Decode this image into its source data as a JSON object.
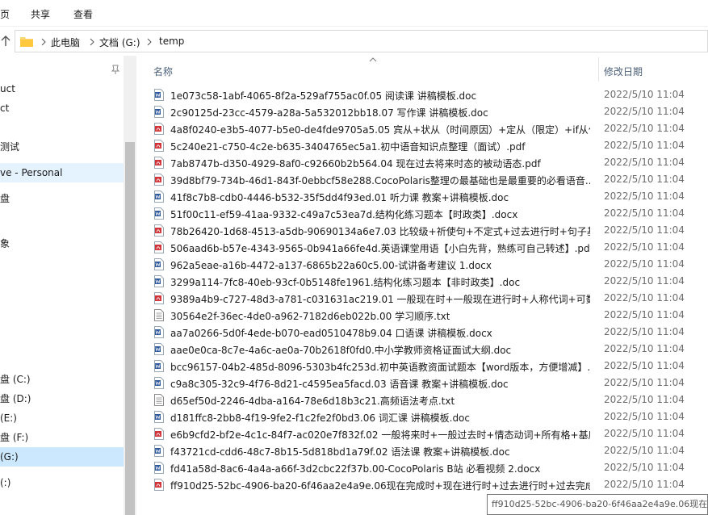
{
  "ribbon": {
    "tabs": [
      "页",
      "共享",
      "查看"
    ]
  },
  "address": {
    "crumbs": [
      "此电脑",
      "文档 (G:)",
      "temp"
    ]
  },
  "nav": {
    "items": [
      {
        "label": "uct"
      },
      {
        "label": "ct"
      },
      {
        "label": "测试"
      },
      {
        "label": "ve - Personal"
      },
      {
        "label": "盘"
      },
      {
        "label": "象"
      },
      {
        "label": "盘 (C:)"
      },
      {
        "label": "盘 (D:)"
      },
      {
        "label": "(E:)"
      },
      {
        "label": "盘 (F:)"
      },
      {
        "label": "(G:)"
      },
      {
        "label": "(:)"
      }
    ]
  },
  "columns": {
    "name": "名称",
    "date": "修改日期"
  },
  "files": [
    {
      "name": "1e073c58-1abf-4065-8f2a-529af755ac0f.05 阅读课 讲稿模板.doc",
      "type": "word",
      "date": "2022/5/10 11:04"
    },
    {
      "name": "2c90125d-23cc-4579-a28a-5a532012bb18.07 写作课 讲稿模板.doc",
      "type": "word",
      "date": "2022/5/10 11:04"
    },
    {
      "name": "4a8f0240-e3b5-4077-b5e0-de4fde9705a5.05 宾从+状从（时间原因）+定从（限定）+if从句...",
      "type": "pdf",
      "date": "2022/5/10 11:04"
    },
    {
      "name": "5c240e21-c750-4c2e-b635-3404765ec5a1.初中语音知识点整理（面试）.pdf",
      "type": "pdf",
      "date": "2022/5/10 11:04"
    },
    {
      "name": "7ab8747b-d350-4929-8af0-c92660b2b564.04 现在过去将来时态的被动语态.pdf",
      "type": "pdf",
      "date": "2022/5/10 11:04"
    },
    {
      "name": "39d8bf79-734b-46d1-843f-0ebbcf58e288.CocoPolaris整理の最基础也是最重要的必看语音...",
      "type": "pdf",
      "date": "2022/5/10 11:04"
    },
    {
      "name": "41f8c7b8-cdb0-4446-b532-35f5dd4f93ed.01 听力课 教案+讲稿模板.doc",
      "type": "word",
      "date": "2022/5/10 11:04"
    },
    {
      "name": "51f00c11-ef59-41aa-9332-c49a7c53ea7d.结构化练习题本【时政类】.docx",
      "type": "word",
      "date": "2022/5/10 11:04"
    },
    {
      "name": "78b26420-1d68-4513-a5db-90690134a6e7.03 比较级+祈使句+不定式+过去进行时+句子基...",
      "type": "pdf",
      "date": "2022/5/10 11:04"
    },
    {
      "name": "506aad6b-b57e-4343-9565-0b941a66fe4d.英语课堂用语【小白先背，熟练可自己转述】.pdf",
      "type": "pdf",
      "date": "2022/5/10 11:04"
    },
    {
      "name": "962a5eae-a16b-4472-a137-6865b22a60c5.00-试讲备考建议 1.docx",
      "type": "word",
      "date": "2022/5/10 11:04"
    },
    {
      "name": "3299a114-7fc8-40eb-93cf-0b5148fe1961.结构化练习题本【非时政类】.doc",
      "type": "word",
      "date": "2022/5/10 11:04"
    },
    {
      "name": "9389a4b9-c727-48d3-a781-c031631ac219.01 一般现在时+一般现在进行时+人称代词+可数...",
      "type": "pdf",
      "date": "2022/5/10 11:04"
    },
    {
      "name": "30564e2f-36ec-4de0-a962-7182d6eb022b.00 学习顺序.txt",
      "type": "txt",
      "date": "2022/5/10 11:04"
    },
    {
      "name": "aa7a0266-5d0f-4ede-b070-ead0510478b9.04 口语课 讲稿模板.docx",
      "type": "word",
      "date": "2022/5/10 11:04"
    },
    {
      "name": "aae0e0ca-8c7e-4a6c-ae0a-70b2618f0fd0.中小学教师资格证面试大纲.doc",
      "type": "word",
      "date": "2022/5/10 11:04"
    },
    {
      "name": "bcc96157-04b2-485d-8096-5303b4fc253d.初中英语教资面试题本【word版本，方便增减】...",
      "type": "word",
      "date": "2022/5/10 11:04"
    },
    {
      "name": "c9a8c305-32c9-4f76-8d21-c4595ea5facd.03 语音课 教案+讲稿模板.doc",
      "type": "word",
      "date": "2022/5/10 11:04"
    },
    {
      "name": "d65ef50d-2246-4dba-a164-78e6d18b3c21.高频语法考点.txt",
      "type": "txt",
      "date": "2022/5/10 11:04"
    },
    {
      "name": "d181ffc8-2bb8-4f19-9fe2-f1c2fe2f0bd3.06 词汇课 讲稿模板.doc",
      "type": "word",
      "date": "2022/5/10 11:04"
    },
    {
      "name": "e6b9cfd2-bf2e-4c1c-84f7-ac020e7f832f.02 一般将来时+一般过去时+情态动词+所有格+基序...",
      "type": "pdf",
      "date": "2022/5/10 11:04"
    },
    {
      "name": "f43721cd-cdd6-48c7-8b15-5d818bd1a79f.02 语法课 教案+讲稿模板.doc",
      "type": "word",
      "date": "2022/5/10 11:04"
    },
    {
      "name": "fd41a58d-8ac6-4a4a-a66f-3d2cbc22f37b.00-CocoPolaris B站 必看视频 2.docx",
      "type": "word",
      "date": "2022/5/10 11:04"
    },
    {
      "name": "ff910d25-52bc-4906-ba20-6f46aa2e4a9e.06现在完成时+现在进行时+过去进行时+过去完成...",
      "type": "pdf",
      "date": "2022/5/10 11:04"
    }
  ],
  "tooltip": {
    "text": "ff910d25-52bc-4906-ba20-6f46aa2e4a9e.06现在"
  },
  "colors": {
    "word": "#2b579a",
    "pdf": "#d13438",
    "txt": "#8a8a8a",
    "accent": "#cce8ff",
    "folder": "#f8d775"
  }
}
